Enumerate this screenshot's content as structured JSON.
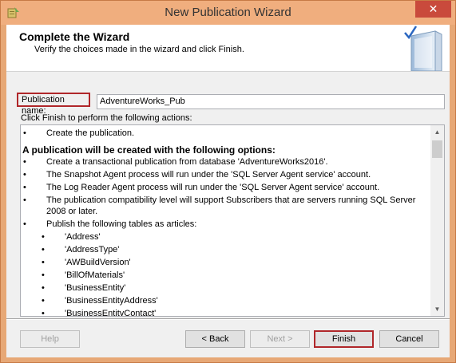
{
  "window": {
    "title": "New Publication Wizard",
    "close_glyph": "✕"
  },
  "header": {
    "title": "Complete the Wizard",
    "subtitle": "Verify the choices made in the wizard and click Finish."
  },
  "publication_name": {
    "label": "Publication name:",
    "value": "AdventureWorks_Pub"
  },
  "actions_caption": "Click Finish to perform the following actions:",
  "summary": {
    "bullet_glyph": "•",
    "first_action": "Create the publication.",
    "options_heading": "A publication will be created with the following options:",
    "options": [
      "Create a transactional publication from database 'AdventureWorks2016'.",
      "The Snapshot Agent process will run under the 'SQL Server Agent service' account.",
      "The Log Reader Agent process will run under the 'SQL Server Agent service' account.",
      "The publication compatibility level will support Subscribers that are servers running SQL Server 2008 or later.",
      "Publish the following tables as articles:"
    ],
    "articles": [
      "'Address'",
      "'AddressType'",
      "'AWBuildVersion'",
      "'BillOfMaterials'",
      "'BusinessEntity'",
      "'BusinessEntityAddress'",
      "'BusinessEntityContact'"
    ]
  },
  "buttons": {
    "help": "Help",
    "back": "< Back",
    "next": "Next >",
    "finish": "Finish",
    "cancel": "Cancel"
  },
  "colors": {
    "highlight_border": "#b0272a",
    "titlebar": "#f0ae7e",
    "close": "#c94a3c"
  }
}
